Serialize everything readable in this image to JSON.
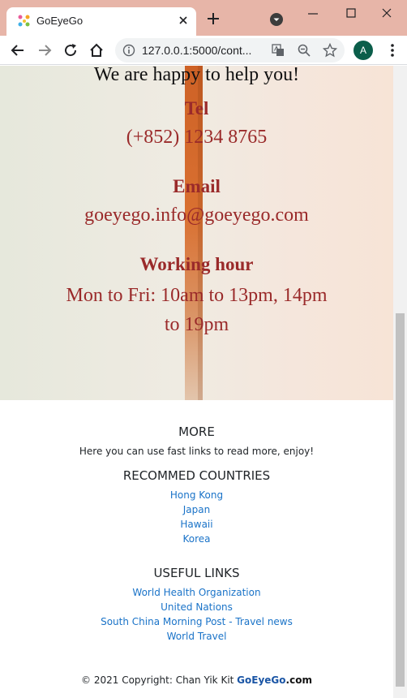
{
  "tab": {
    "title": "GoEyeGo"
  },
  "address_bar": {
    "url": "127.0.0.1:5000/cont..."
  },
  "profile": {
    "initial": "A"
  },
  "hero": {
    "intro": "We are happy to help you!",
    "tel_label": "Tel",
    "tel_value": "(+852) 1234 8765",
    "email_label": "Email",
    "email_value": "goeyego.info@goeyego.com",
    "hours_label": "Working hour",
    "hours_line1": "Mon to Fri: 10am to 13pm, 14pm",
    "hours_line2": "to 19pm"
  },
  "footer": {
    "more_title": "MORE",
    "more_text": "Here you can use fast links to read more, enjoy!",
    "countries_title": "RECOMMED COUNTRIES",
    "countries": [
      "Hong Kong",
      "Japan",
      "Hawaii",
      "Korea"
    ],
    "links_title": "USEFUL LINKS",
    "links": [
      "World Health Organization",
      "United Nations",
      "South China Morning Post - Travel news",
      "World Travel"
    ],
    "copyright_prefix": "© 2021 Copyright: Chan Yik Kit ",
    "copyright_brand": "GoEyeGo",
    "copyright_suffix": ".com"
  },
  "colors": {
    "accent_link": "#1a73c8",
    "contact_text": "#9a2a2a",
    "tab_strip": "#e7b5a8"
  }
}
